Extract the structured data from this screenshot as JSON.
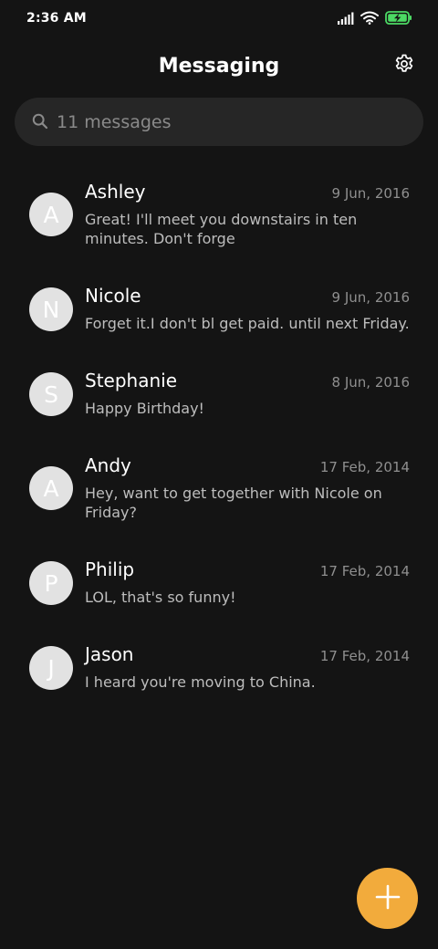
{
  "status_bar": {
    "time": "2:36 AM",
    "icons": [
      "signal-icon",
      "wifi-icon",
      "battery-charging-icon"
    ],
    "battery_color": "#4cd964"
  },
  "header": {
    "title": "Messaging",
    "settings_icon": "gear-icon"
  },
  "search": {
    "placeholder": "11 messages",
    "icon": "search-icon"
  },
  "conversations": [
    {
      "initial": "A",
      "name": "Ashley",
      "date": "9 Jun, 2016",
      "snippet": "Great! I'll meet you downstairs in ten minutes. Don't forge"
    },
    {
      "initial": "N",
      "name": "Nicole",
      "date": "9 Jun, 2016",
      "snippet": "Forget it.I don't bl get paid. until next Friday."
    },
    {
      "initial": "S",
      "name": "Stephanie",
      "date": "8 Jun, 2016",
      "snippet": "Happy Birthday!"
    },
    {
      "initial": "A",
      "name": "Andy",
      "date": "17 Feb, 2014",
      "snippet": "Hey, want to get together with Nicole on Friday?"
    },
    {
      "initial": "P",
      "name": "Philip",
      "date": "17 Feb, 2014",
      "snippet": "LOL, that's so funny!"
    },
    {
      "initial": "J",
      "name": "Jason",
      "date": "17 Feb, 2014",
      "snippet": "I heard you're moving to China."
    }
  ],
  "fab": {
    "icon": "plus-icon",
    "color": "#f2ab3c"
  }
}
